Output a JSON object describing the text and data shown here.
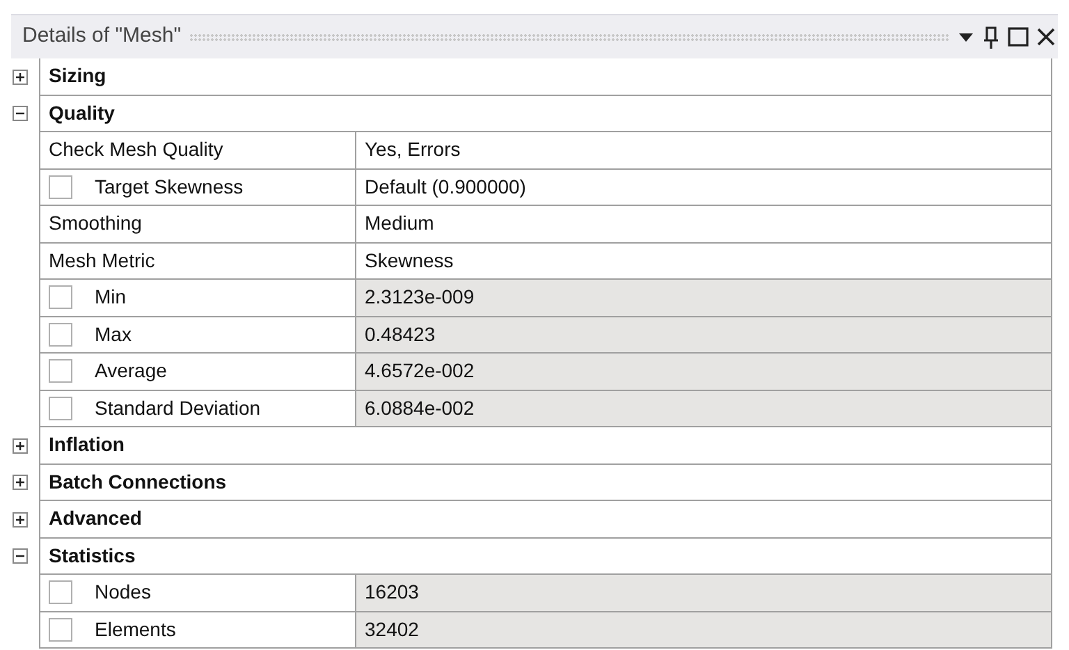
{
  "panel": {
    "title": "Details of \"Mesh\""
  },
  "groups": [
    {
      "label": "Sizing",
      "expanded": false
    },
    {
      "label": "Quality",
      "expanded": true,
      "rows": [
        {
          "kind": "plain",
          "name": "Check Mesh Quality",
          "value": "Yes, Errors",
          "readonly": false
        },
        {
          "kind": "checkbox",
          "checked": false,
          "name": "Target Skewness",
          "value": "Default (0.900000)",
          "readonly": false
        },
        {
          "kind": "plain",
          "name": "Smoothing",
          "value": "Medium",
          "readonly": false
        },
        {
          "kind": "plain",
          "name": "Mesh Metric",
          "value": "Skewness",
          "readonly": false
        },
        {
          "kind": "checkbox",
          "checked": false,
          "name": "Min",
          "value": "2.3123e-009",
          "readonly": true
        },
        {
          "kind": "checkbox",
          "checked": false,
          "name": "Max",
          "value": "0.48423",
          "readonly": true
        },
        {
          "kind": "checkbox",
          "checked": false,
          "name": "Average",
          "value": "4.6572e-002",
          "readonly": true
        },
        {
          "kind": "checkbox",
          "checked": false,
          "name": "Standard Deviation",
          "value": "6.0884e-002",
          "readonly": true
        }
      ]
    },
    {
      "label": "Inflation",
      "expanded": false
    },
    {
      "label": "Batch Connections",
      "expanded": false
    },
    {
      "label": "Advanced",
      "expanded": false
    },
    {
      "label": "Statistics",
      "expanded": true,
      "rows": [
        {
          "kind": "checkbox",
          "checked": false,
          "name": "Nodes",
          "value": "16203",
          "readonly": true
        },
        {
          "kind": "checkbox",
          "checked": false,
          "name": "Elements",
          "value": "32402",
          "readonly": true
        }
      ]
    }
  ]
}
